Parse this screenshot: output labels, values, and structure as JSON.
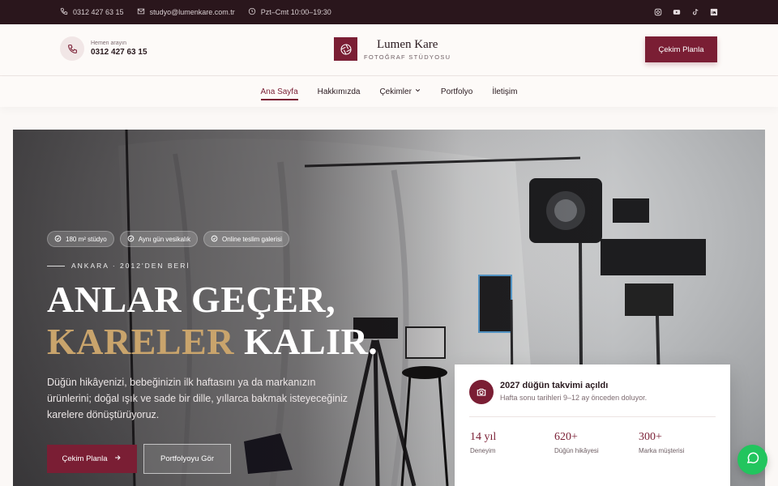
{
  "topbar": {
    "phone": "0312 427 63 15",
    "email": "studyo@lumenkare.com.tr",
    "hours": "Pzt–Cmt 10:00–19:30",
    "socials": [
      "instagram-icon",
      "youtube-icon",
      "tiktok-icon",
      "linkedin-icon"
    ]
  },
  "header": {
    "call_label": "Hemen arayın",
    "call_phone": "0312 427 63 15",
    "brand_name": "Lumen Kare",
    "brand_sub": "FOTOĞRAF STÜDYOSU",
    "cta": "Çekim Planla"
  },
  "nav": {
    "items": [
      {
        "label": "Ana Sayfa",
        "active": true
      },
      {
        "label": "Hakkımızda"
      },
      {
        "label": "Çekimler",
        "dropdown": true
      },
      {
        "label": "Portfolyo"
      },
      {
        "label": "İletişim"
      }
    ]
  },
  "hero": {
    "chips": [
      "180 m² stüdyo",
      "Aynı gün vesikalık",
      "Online teslim galerisi"
    ],
    "eyebrow": "ANKARA · 2012'DEN BERİ",
    "headline_line1": "ANLAR GEÇER,",
    "headline_gold": "KARELER",
    "headline_rest": " KALIR.",
    "lead": "Düğün hikâyenizi, bebeğinizin ilk haftasını ya da markanızın ürünlerini; doğal ışık ve sade bir dille, yıllarca bakmak isteyeceğiniz karelere dönüştürüyoruz.",
    "btn_primary": "Çekim Planla",
    "btn_secondary": "Portfolyoyu Gör"
  },
  "card": {
    "title": "2027 düğün takvimi açıldı",
    "subtitle": "Hafta sonu tarihleri 9–12 ay önceden doluyor.",
    "stats": [
      {
        "value": "14 yıl",
        "label": "Deneyim"
      },
      {
        "value": "620+",
        "label": "Düğün hikâyesi"
      },
      {
        "value": "300+",
        "label": "Marka müşterisi"
      }
    ]
  },
  "colors": {
    "accent": "#7a1e34",
    "gold": "#c9a46c",
    "topbar": "#2a161c",
    "whatsapp": "#22c55e"
  }
}
